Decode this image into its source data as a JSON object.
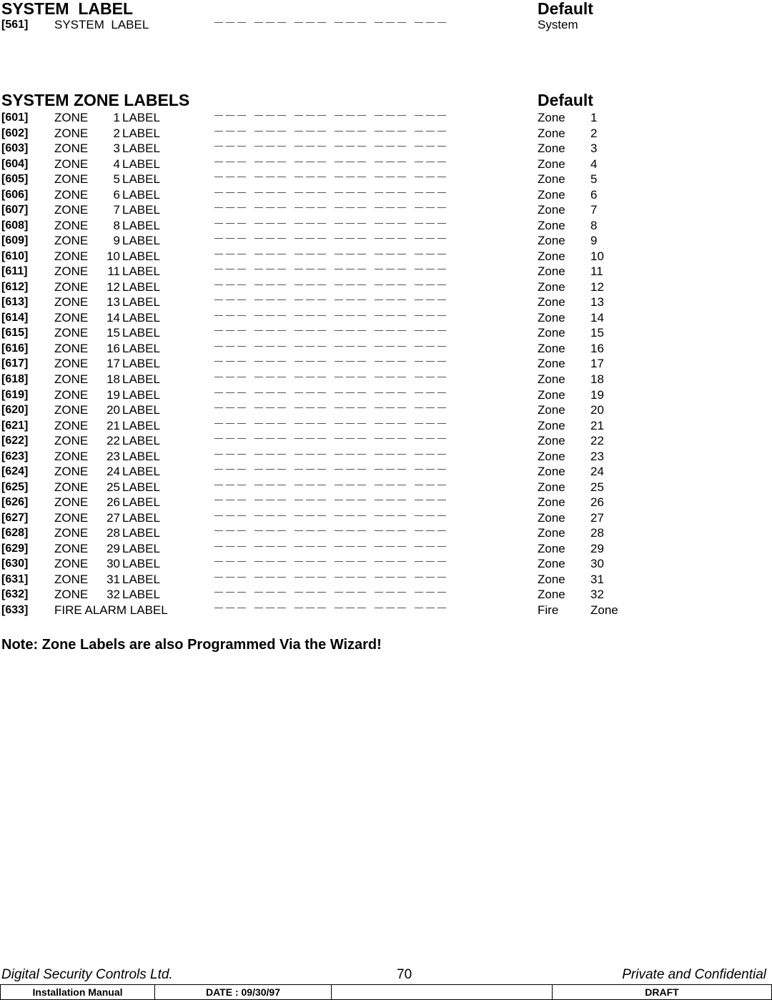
{
  "system_label_section": {
    "title": "SYSTEM  LABEL",
    "default_header": "Default",
    "rows": [
      {
        "code": "[561]",
        "label": "SYSTEM  LABEL",
        "default": "System"
      }
    ]
  },
  "zone_labels_section": {
    "title": "SYSTEM ZONE LABELS",
    "default_header": "Default",
    "rows": [
      {
        "code": "[601]",
        "zone": "ZONE",
        "num": "1",
        "label": "LABEL",
        "def1": "Zone",
        "def2": "1"
      },
      {
        "code": "[602]",
        "zone": "ZONE",
        "num": "2",
        "label": "LABEL",
        "def1": "Zone",
        "def2": "2"
      },
      {
        "code": "[603]",
        "zone": "ZONE",
        "num": "3",
        "label": "LABEL",
        "def1": "Zone",
        "def2": "3"
      },
      {
        "code": "[604]",
        "zone": "ZONE",
        "num": "4",
        "label": "LABEL",
        "def1": "Zone",
        "def2": "4"
      },
      {
        "code": "[605]",
        "zone": "ZONE",
        "num": "5",
        "label": "LABEL",
        "def1": "Zone",
        "def2": "5"
      },
      {
        "code": "[606]",
        "zone": "ZONE",
        "num": "6",
        "label": "LABEL",
        "def1": "Zone",
        "def2": "6"
      },
      {
        "code": "[607]",
        "zone": "ZONE",
        "num": "7",
        "label": "LABEL",
        "def1": "Zone",
        "def2": "7"
      },
      {
        "code": "[608]",
        "zone": "ZONE",
        "num": "8",
        "label": "LABEL",
        "def1": "Zone",
        "def2": "8"
      },
      {
        "code": "[609]",
        "zone": "ZONE",
        "num": "9",
        "label": "LABEL",
        "def1": "Zone",
        "def2": "9"
      },
      {
        "code": "[610]",
        "zone": "ZONE",
        "num": "10",
        "label": "LABEL",
        "def1": "Zone",
        "def2": "10"
      },
      {
        "code": "[611]",
        "zone": "ZONE",
        "num": "11",
        "label": "LABEL",
        "def1": "Zone",
        "def2": "11"
      },
      {
        "code": "[612]",
        "zone": "ZONE",
        "num": "12",
        "label": "LABEL",
        "def1": "Zone",
        "def2": "12"
      },
      {
        "code": "[613]",
        "zone": "ZONE",
        "num": "13",
        "label": "LABEL",
        "def1": "Zone",
        "def2": "13"
      },
      {
        "code": "[614]",
        "zone": "ZONE",
        "num": "14",
        "label": "LABEL",
        "def1": "Zone",
        "def2": "14"
      },
      {
        "code": "[615]",
        "zone": "ZONE",
        "num": "15",
        "label": "LABEL",
        "def1": "Zone",
        "def2": "15"
      },
      {
        "code": "[616]",
        "zone": "ZONE",
        "num": "16",
        "label": "LABEL",
        "def1": "Zone",
        "def2": "16"
      },
      {
        "code": "[617]",
        "zone": "ZONE",
        "num": "17",
        "label": "LABEL",
        "def1": "Zone",
        "def2": "17"
      },
      {
        "code": "[618]",
        "zone": "ZONE",
        "num": "18",
        "label": "LABEL",
        "def1": "Zone",
        "def2": "18"
      },
      {
        "code": "[619]",
        "zone": "ZONE",
        "num": "19",
        "label": "LABEL",
        "def1": "Zone",
        "def2": "19"
      },
      {
        "code": "[620]",
        "zone": "ZONE",
        "num": "20",
        "label": "LABEL",
        "def1": "Zone",
        "def2": "20"
      },
      {
        "code": "[621]",
        "zone": "ZONE",
        "num": "21",
        "label": "LABEL",
        "def1": "Zone",
        "def2": "21"
      },
      {
        "code": "[622]",
        "zone": "ZONE",
        "num": "22",
        "label": "LABEL",
        "def1": "Zone",
        "def2": "22"
      },
      {
        "code": "[623]",
        "zone": "ZONE",
        "num": "23",
        "label": "LABEL",
        "def1": "Zone",
        "def2": "23"
      },
      {
        "code": "[624]",
        "zone": "ZONE",
        "num": "24",
        "label": "LABEL",
        "def1": "Zone",
        "def2": "24"
      },
      {
        "code": "[625]",
        "zone": "ZONE",
        "num": "25",
        "label": "LABEL",
        "def1": "Zone",
        "def2": "25"
      },
      {
        "code": "[626]",
        "zone": "ZONE",
        "num": "26",
        "label": "LABEL",
        "def1": "Zone",
        "def2": "26"
      },
      {
        "code": "[627]",
        "zone": "ZONE",
        "num": "27",
        "label": "LABEL",
        "def1": "Zone",
        "def2": "27"
      },
      {
        "code": "[628]",
        "zone": "ZONE",
        "num": "28",
        "label": "LABEL",
        "def1": "Zone",
        "def2": "28"
      },
      {
        "code": "[629]",
        "zone": "ZONE",
        "num": "29",
        "label": "LABEL",
        "def1": "Zone",
        "def2": "29"
      },
      {
        "code": "[630]",
        "zone": "ZONE",
        "num": "30",
        "label": "LABEL",
        "def1": "Zone",
        "def2": "30"
      },
      {
        "code": "[631]",
        "zone": "ZONE",
        "num": "31",
        "label": "LABEL",
        "def1": "Zone",
        "def2": "31"
      },
      {
        "code": "[632]",
        "zone": "ZONE",
        "num": "32",
        "label": "LABEL",
        "def1": "Zone",
        "def2": "32"
      }
    ],
    "fire_row": {
      "code": "[633]",
      "label": "FIRE ALARM LABEL",
      "def1": "Fire",
      "def2": "Zone"
    }
  },
  "blank_entry": {
    "groups": 6,
    "underscores_per_group": 3
  },
  "note": "Note: Zone Labels are also Programmed Via the Wizard!",
  "footer": {
    "company": "Digital Security Controls Ltd.",
    "page_number": "70",
    "confidentiality": "Private and Confidential",
    "table": {
      "doc_type": "Installation Manual",
      "date": "DATE :  09/30/97",
      "blank": "",
      "status": "DRAFT"
    }
  }
}
